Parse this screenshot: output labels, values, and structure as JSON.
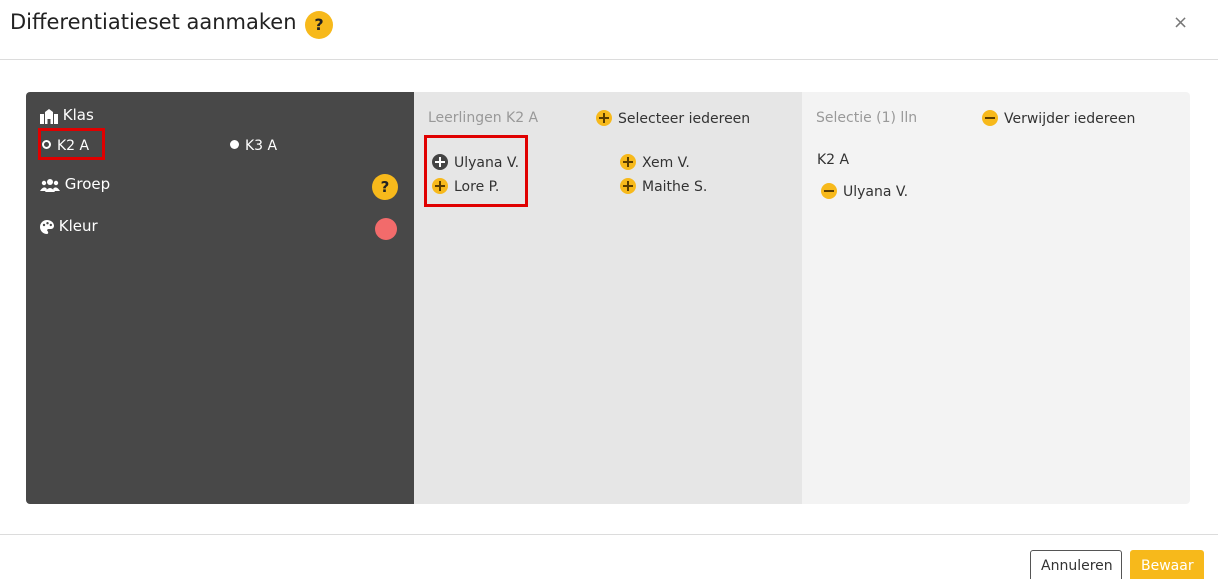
{
  "dialog": {
    "title": "Differentiatieset aanmaken",
    "help_label": "?",
    "close_label": "×"
  },
  "left_panel": {
    "klas_label": "Klas",
    "classes": [
      {
        "label": "K2 A",
        "selected": true
      },
      {
        "label": "K3 A",
        "selected": false
      }
    ],
    "groep_label": "Groep",
    "groep_help": "?",
    "kleur_label": "Kleur",
    "kleur_color": "#f26b6b"
  },
  "students_panel": {
    "header": "Leerlingen K2 A",
    "select_all_label": "Selecteer iedereen",
    "students": [
      {
        "name": "Ulyana V.",
        "selected": true
      },
      {
        "name": "Xem V.",
        "selected": false
      },
      {
        "name": "Lore P.",
        "selected": false
      },
      {
        "name": "Maithe S.",
        "selected": false
      }
    ]
  },
  "selection_panel": {
    "header": "Selectie (1) lln",
    "remove_all_label": "Verwijder iedereen",
    "group_label": "K2 A",
    "selected": [
      "Ulyana V."
    ]
  },
  "footer": {
    "cancel_label": "Annuleren",
    "save_label": "Bewaar"
  },
  "colors": {
    "accent": "#f7b91b",
    "dark_panel": "#484848",
    "highlight": "#e00000"
  }
}
